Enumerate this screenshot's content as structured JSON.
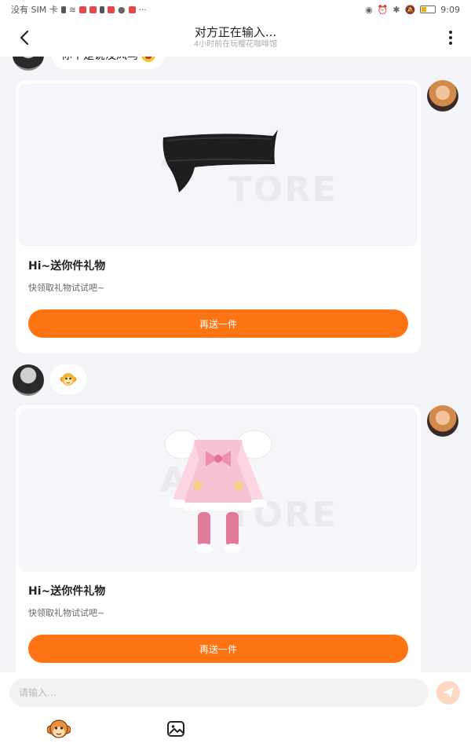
{
  "status_bar": {
    "carrier": "没有 SIM 卡",
    "time": "9:09"
  },
  "header": {
    "title": "对方正在输入...",
    "subtitle": "4小时前在玩樱花咖啡馆"
  },
  "messages": [
    {
      "side": "left",
      "type": "text",
      "text": "你不是说没风乌"
    },
    {
      "side": "right",
      "type": "gift",
      "watermark": "AU　\nTORE",
      "title": "Hi~送你件礼物",
      "desc": "快领取礼物试试吧~",
      "button": "再送一件"
    },
    {
      "side": "left",
      "type": "emoji",
      "icon": "monkey-emoji"
    },
    {
      "side": "right",
      "type": "gift",
      "watermark": "AU　\nTORE",
      "title": "Hi~送你件礼物",
      "desc": "快领取礼物试试吧~",
      "button": "再送一件"
    }
  ],
  "input_bar": {
    "placeholder": "请输入...",
    "sticker_icon": "monkey-sticker-icon",
    "image_icon": "image-icon",
    "send_icon": "send-icon"
  },
  "colors": {
    "accent": "#ff7412",
    "background": "#f3f4f8",
    "send_button_disabled": "#ffd8c4"
  }
}
